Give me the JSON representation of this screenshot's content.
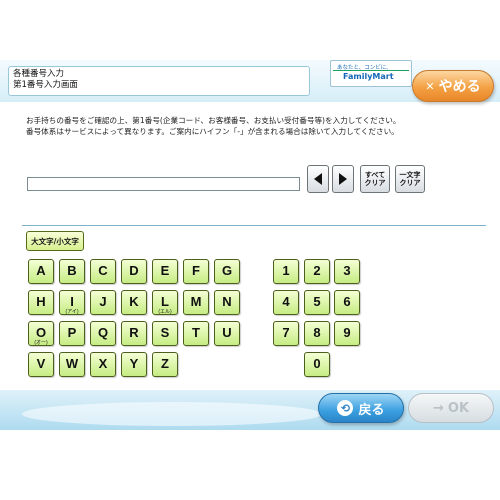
{
  "header": {
    "title_line1": "各種番号入力",
    "title_line2": "第1番号入力画面",
    "brand_slogan": "あなたと、コンビに、",
    "brand_logo": "FamilyMart",
    "quit_label": "やめる"
  },
  "instructions": {
    "line1": "お手持ちの番号をご確認の上、第1番号(企業コード、お客様番号、お支払い受付番号等)を入力してください。",
    "line2": "番号体系はサービスによって異なります。ご案内にハイフン「-」が含まれる場合は除いて入力してください。"
  },
  "input": {
    "value": "",
    "placeholder": ""
  },
  "controls": {
    "clear_all_line1": "すべて",
    "clear_all_line2": "クリア",
    "clear_one_line1": "一文字",
    "clear_one_line2": "クリア"
  },
  "keyboard": {
    "case_toggle_label": "大文字/小文字",
    "letters": [
      {
        "label": "A",
        "sub": ""
      },
      {
        "label": "B",
        "sub": ""
      },
      {
        "label": "C",
        "sub": ""
      },
      {
        "label": "D",
        "sub": ""
      },
      {
        "label": "E",
        "sub": ""
      },
      {
        "label": "F",
        "sub": ""
      },
      {
        "label": "G",
        "sub": ""
      },
      {
        "label": "H",
        "sub": ""
      },
      {
        "label": "I",
        "sub": "(アイ)"
      },
      {
        "label": "J",
        "sub": ""
      },
      {
        "label": "K",
        "sub": ""
      },
      {
        "label": "L",
        "sub": "(エル)"
      },
      {
        "label": "M",
        "sub": ""
      },
      {
        "label": "N",
        "sub": ""
      },
      {
        "label": "O",
        "sub": "(オー)"
      },
      {
        "label": "P",
        "sub": ""
      },
      {
        "label": "Q",
        "sub": ""
      },
      {
        "label": "R",
        "sub": ""
      },
      {
        "label": "S",
        "sub": ""
      },
      {
        "label": "T",
        "sub": ""
      },
      {
        "label": "U",
        "sub": ""
      },
      {
        "label": "V",
        "sub": ""
      },
      {
        "label": "W",
        "sub": ""
      },
      {
        "label": "X",
        "sub": ""
      },
      {
        "label": "Y",
        "sub": ""
      },
      {
        "label": "Z",
        "sub": ""
      }
    ],
    "digits": [
      "1",
      "2",
      "3",
      "4",
      "5",
      "6",
      "7",
      "8",
      "9",
      "0"
    ]
  },
  "footer": {
    "back_label": "戻る",
    "ok_label": "OK"
  },
  "colors": {
    "quit_button": "#f4a144",
    "back_button": "#3b9fe0",
    "key_face": "#c6ec83",
    "ok_disabled": "#d6dde1"
  }
}
